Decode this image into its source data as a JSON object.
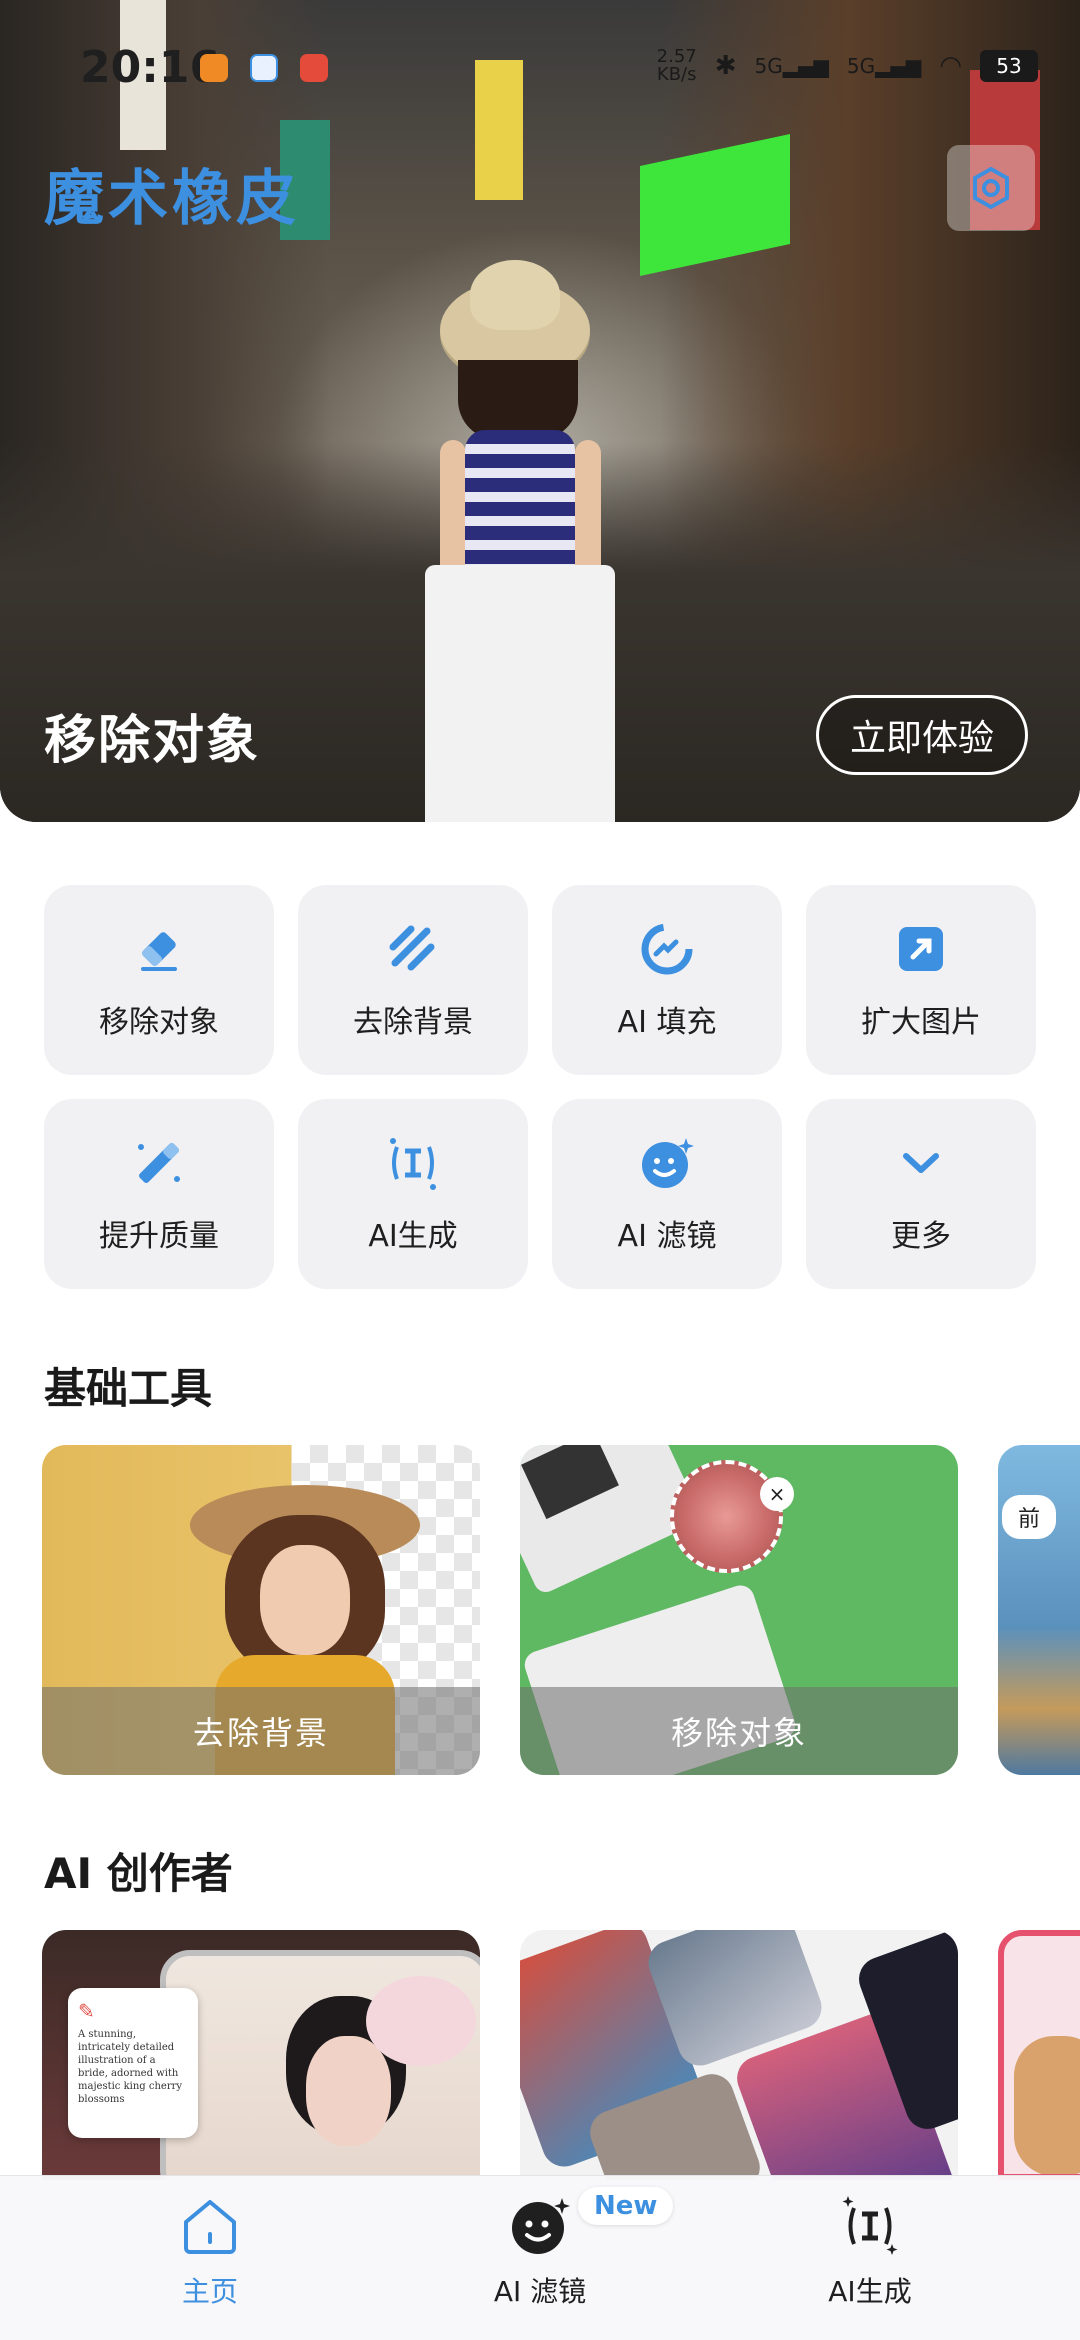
{
  "status_bar": {
    "time": "20:16",
    "net_speed_value": "2.57",
    "net_speed_unit": "KB/s",
    "signal_1": "5G",
    "signal_2": "5G",
    "battery": "53"
  },
  "header": {
    "app_title": "魔术橡皮",
    "settings_icon": "settings-hexagon-icon"
  },
  "hero": {
    "label": "移除对象",
    "cta": "立即体验"
  },
  "tools": [
    {
      "label": "移除对象",
      "icon": "eraser-icon"
    },
    {
      "label": "去除背景",
      "icon": "stripes-icon"
    },
    {
      "label": "AI 填充",
      "icon": "ai-fill-icon"
    },
    {
      "label": "扩大图片",
      "icon": "expand-icon"
    },
    {
      "label": "提升质量",
      "icon": "magic-wand-icon"
    },
    {
      "label": "AI生成",
      "icon": "ai-generate-icon"
    },
    {
      "label": "AI 滤镜",
      "icon": "smile-sparkle-icon"
    },
    {
      "label": "更多",
      "icon": "chevron-down-icon"
    }
  ],
  "basic_tools": {
    "title": "基础工具",
    "cards": [
      {
        "caption": "去除背景"
      },
      {
        "caption": "移除对象"
      },
      {
        "caption": "",
        "tag": "前"
      }
    ]
  },
  "ai_creator": {
    "title": "AI 创作者",
    "prompt_text": "A stunning, intricately detailed illustration of a bride, adorned with majestic king cherry blossoms"
  },
  "tabbar": {
    "items": [
      {
        "label": "主页",
        "icon": "home-icon",
        "active": true
      },
      {
        "label": "AI 滤镜",
        "icon": "smile-sparkle-icon",
        "active": false
      },
      {
        "label": "AI生成",
        "icon": "ai-generate-icon",
        "active": false
      }
    ],
    "new_badge": "New"
  },
  "colors": {
    "accent": "#3d8fe0",
    "tile_bg": "#f1f1f3",
    "text": "#1f1f1f"
  }
}
